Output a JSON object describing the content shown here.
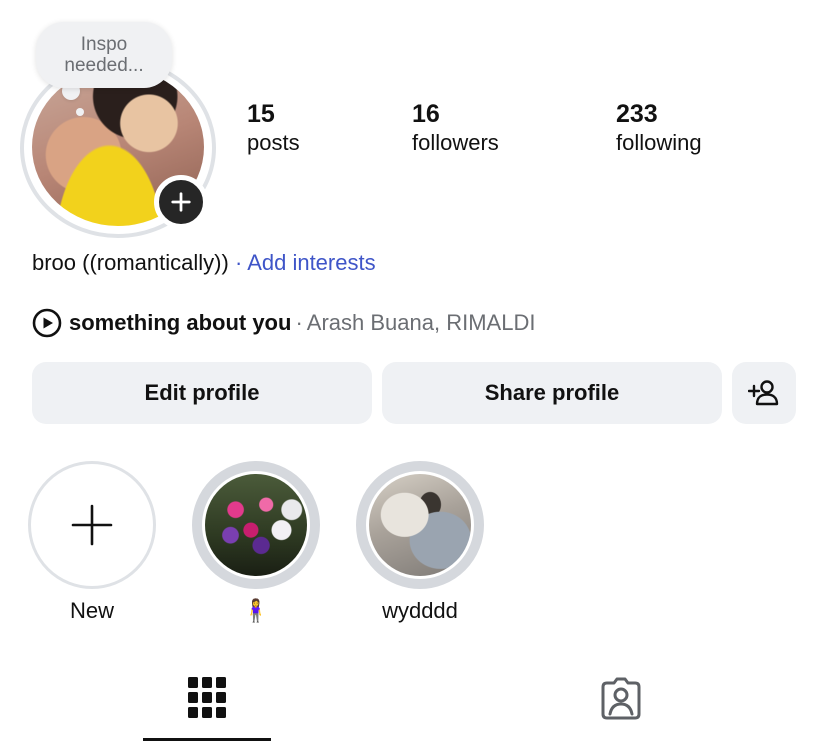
{
  "profile": {
    "note": {
      "line1": "Inspo",
      "line2": "needed..."
    },
    "avatar_alt": "profile photo",
    "stats": [
      {
        "num": "15",
        "label": "posts"
      },
      {
        "num": "16",
        "label": "followers"
      },
      {
        "num": "233",
        "label": "following"
      }
    ],
    "bio": {
      "text": "broo ((romantically))",
      "separator": "·",
      "link": "Add interests"
    },
    "music": {
      "song": "something about you",
      "separator": "·",
      "artist": "Arash Buana, RIMALDI"
    },
    "buttons": {
      "edit": "Edit profile",
      "share": "Share profile"
    }
  },
  "highlights": [
    {
      "label": "New"
    },
    {
      "label": "🧍‍♀️"
    },
    {
      "label": "wydddd"
    }
  ],
  "tabs": {
    "active": "grid",
    "icons": [
      "grid-icon",
      "tagged-icon"
    ]
  },
  "colors": {
    "link": "#3f55c8",
    "button_bg": "#eff1f4",
    "muted": "#6b6e73"
  }
}
